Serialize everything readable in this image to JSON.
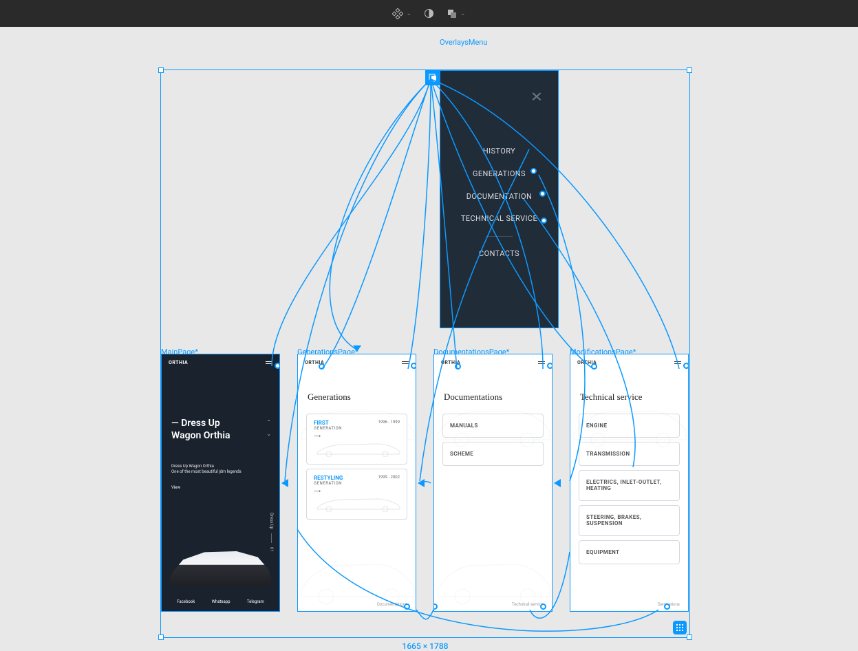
{
  "toolbar": {
    "component_chevron": "⌄",
    "contrast_tool": "contrast",
    "layers_chevron": "⌄"
  },
  "selection": {
    "dimensions": "1665 × 1788"
  },
  "overlayMenu": {
    "frame_name": "OverlaysMenu",
    "items": [
      "HISTORY",
      "GENERATIONS",
      "DOCUMENTATION",
      "TECHNICAL SERVICE",
      "CONTACTS"
    ]
  },
  "mainPage": {
    "frame_name": "MainPage*",
    "logo": "ORTHIA",
    "hero_prefix": "—",
    "hero_title_1": "Dress Up",
    "hero_title_2": "Wagon Orthia",
    "hero_sub_1": "Dress Up Wagon Orthia",
    "hero_sub_2": "One of the most beautiful jdm legends",
    "view": "View",
    "side_label": "Dress Up",
    "side_num": "01",
    "social": [
      "Facebook",
      "Whatsapp",
      "Telegram"
    ]
  },
  "generationsPage": {
    "frame_name": "GenerationsPage*",
    "logo": "ORTHIA",
    "title": "Generations",
    "cards": [
      {
        "title": "FIRST",
        "sub": "GENERATION",
        "years": "1996 - 1999"
      },
      {
        "title": "RESTYLING",
        "sub": "GENERATION",
        "years": "1999 - 2002"
      }
    ],
    "footer": "Documentations"
  },
  "documentationsPage": {
    "frame_name": "DocumentationsPage*",
    "logo": "ORTHIA",
    "title": "Documentations",
    "cards": [
      "MANUALS",
      "SCHEME"
    ],
    "footer": "Technical service"
  },
  "modificationsPage": {
    "frame_name": "ModificationsPage*",
    "logo": "ORTHIA",
    "title": "Technical service",
    "cards": [
      "ENGINE",
      "TRANSMISSION",
      "ELECTRICS, INLET-OUTLET, HEATING",
      "STEERING, BRAKES, SUSPENSION",
      "EQUIPMENT"
    ],
    "footer": "Generations"
  }
}
